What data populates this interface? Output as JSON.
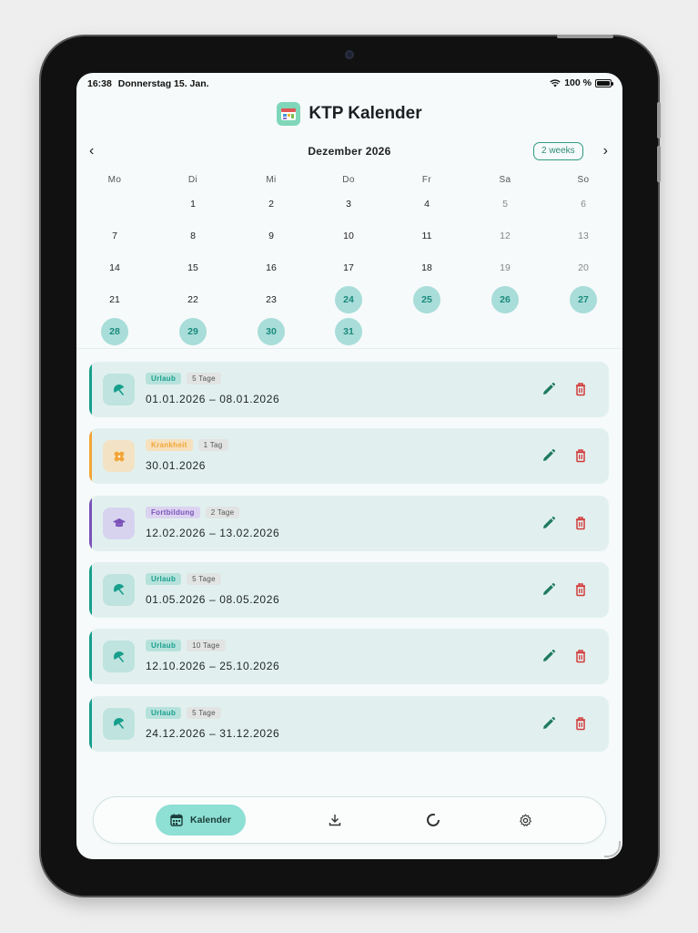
{
  "status_bar": {
    "time": "16:38",
    "date": "Donnerstag 15. Jan.",
    "battery": "100 %"
  },
  "app": {
    "title": "KTP Kalender"
  },
  "calendar": {
    "month_label": "Dezember 2026",
    "view_toggle": "2 weeks",
    "weekdays": [
      "Mo",
      "Di",
      "Mi",
      "Do",
      "Fr",
      "Sa",
      "So"
    ],
    "days": [
      "1",
      "2",
      "3",
      "4",
      "5",
      "6",
      "7",
      "8",
      "9",
      "10",
      "11",
      "12",
      "13",
      "14",
      "15",
      "16",
      "17",
      "18",
      "19",
      "20",
      "21",
      "22",
      "23",
      "24",
      "25",
      "26",
      "27",
      "28",
      "29",
      "30",
      "31"
    ],
    "first_weekday_index": 1,
    "highlighted_from": 24,
    "highlight_color": "#a8ddd9"
  },
  "entries": [
    {
      "type": "Urlaub",
      "days": "5 Tage",
      "dates": "01.01.2026 – 08.01.2026",
      "icon": "umbrella-icon",
      "color": "#179f8c"
    },
    {
      "type": "Krankheit",
      "days": "1 Tag",
      "dates": "30.01.2026",
      "icon": "bandage-icon",
      "color": "#f2a536"
    },
    {
      "type": "Fortbildung",
      "days": "2 Tage",
      "dates": "12.02.2026 – 13.02.2026",
      "icon": "graduation-cap-icon",
      "color": "#7a52b8"
    },
    {
      "type": "Urlaub",
      "days": "5 Tage",
      "dates": "01.05.2026 – 08.05.2026",
      "icon": "umbrella-icon",
      "color": "#179f8c"
    },
    {
      "type": "Urlaub",
      "days": "10 Tage",
      "dates": "12.10.2026 – 25.10.2026",
      "icon": "umbrella-icon",
      "color": "#179f8c"
    },
    {
      "type": "Urlaub",
      "days": "5 Tage",
      "dates": "24.12.2026 – 31.12.2026",
      "icon": "umbrella-icon",
      "color": "#179f8c"
    }
  ],
  "bottom_nav": {
    "items": [
      {
        "label": "Kalender",
        "icon": "calendar-icon",
        "active": true
      },
      {
        "label": "",
        "icon": "download-icon",
        "active": false
      },
      {
        "label": "",
        "icon": "progress-ring-icon",
        "active": false
      },
      {
        "label": "",
        "icon": "gear-icon",
        "active": false
      }
    ]
  },
  "colors": {
    "accent": "#179f8c",
    "delete": "#d23b3b",
    "edit": "#1f7a5e",
    "active_nav": "#8edfd4"
  }
}
